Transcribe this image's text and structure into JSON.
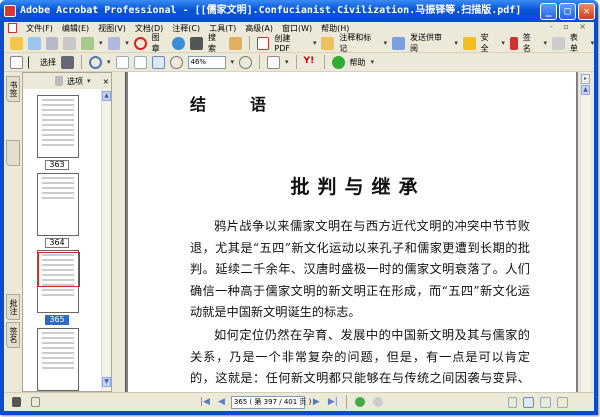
{
  "window": {
    "title": "Adobe Acrobat Professional - [[儒家文明].Confucianist.Civilization.马振铎等.扫描版.pdf]",
    "minimize": "_",
    "maximize": "□",
    "close": "✕"
  },
  "menu": [
    "文件(F)",
    "编辑(E)",
    "视图(V)",
    "文档(D)",
    "注释(C)",
    "工具(T)",
    "高级(A)",
    "窗口(W)",
    "帮助(H)"
  ],
  "toolbar1": {
    "stamp": "图章",
    "search": "搜索",
    "create_pdf": "创建 PDF",
    "comment": "注释和标记",
    "send_review": "发送供审阅",
    "security": "安全",
    "sign": "签名",
    "forms": "表单"
  },
  "toolbar2": {
    "select": "选择",
    "zoom": "46%",
    "help": "帮助"
  },
  "left_tabs": [
    "书签",
    "批注",
    "签名"
  ],
  "panel": {
    "options": "选项",
    "close": "×",
    "pages": [
      "363",
      "364",
      "365"
    ],
    "selected_page": "365"
  },
  "document": {
    "heading": "结　语",
    "title": "批判与继承",
    "paragraphs": [
      "鸦片战争以来儒家文明在与西方近代文明的冲突中节节败退，尤其是“五四”新文化运动以来孔子和儒家更遭到长期的批判。延续二千余年、汉唐时盛极一时的儒家文明衰落了。人们确信一种高于儒家文明的新文明正在形成，而“五四”新文化运动就是中国新文明诞生的标志。",
      "如何定位仍然在孕育、发展中的中国新文明及其与儒家的关系，乃是一个非常复杂的问题，但是，有一点是可以肯定的，这就是：任何新文明都只能够在与传统之间因袭与变异、批判与继承的复杂关系中形成、发展。",
      "……"
    ]
  },
  "status": {
    "page_field": "365 ( 第 397 / 401 页 )",
    "current_page": 397,
    "total_pages": 401
  }
}
